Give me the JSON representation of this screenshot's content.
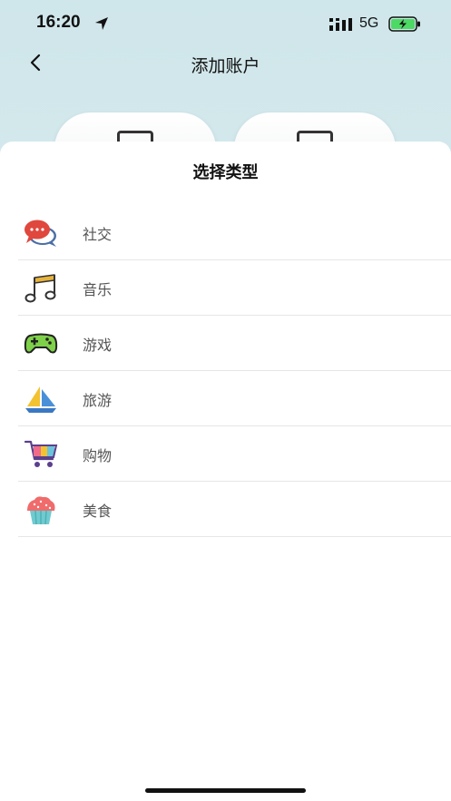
{
  "status_bar": {
    "time": "16:20",
    "network": "5G"
  },
  "nav": {
    "title": "添加账户"
  },
  "sheet": {
    "title": "选择类型",
    "items": [
      {
        "label": "社交",
        "icon": "chat-bubbles-icon"
      },
      {
        "label": "音乐",
        "icon": "music-note-icon"
      },
      {
        "label": "游戏",
        "icon": "gamepad-icon"
      },
      {
        "label": "旅游",
        "icon": "sailboat-icon"
      },
      {
        "label": "购物",
        "icon": "shopping-cart-icon"
      },
      {
        "label": "美食",
        "icon": "cupcake-icon"
      }
    ]
  },
  "colors": {
    "chat_red": "#e0473d",
    "music_gold": "#e8b33c",
    "gamepad_green": "#7fd14a",
    "sail_blue": "#4a90d9",
    "cart_purple": "#5b3f8c",
    "cupcake_pink": "#f06b6b"
  }
}
